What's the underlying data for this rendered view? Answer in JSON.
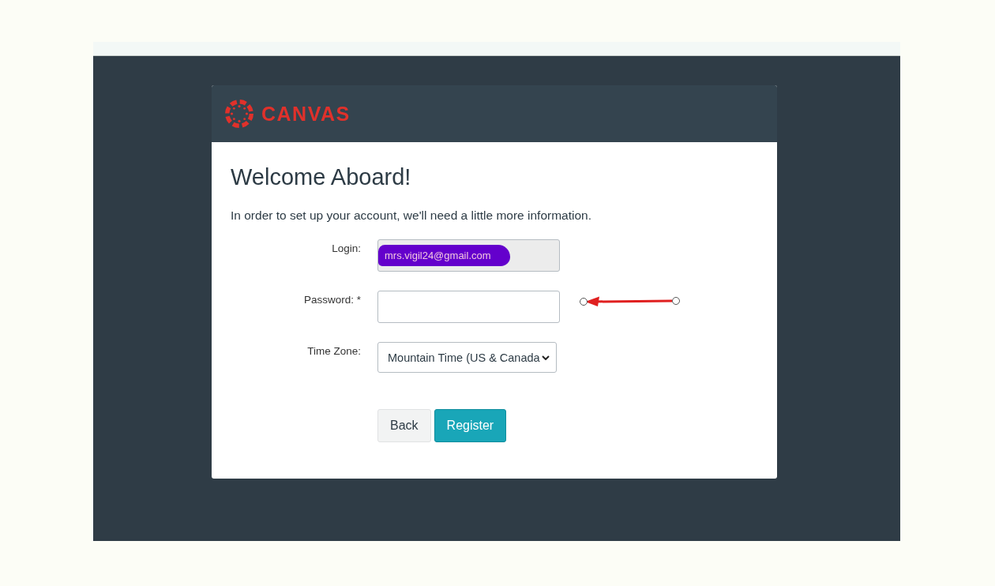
{
  "header": {
    "logo_text": "CANVAS"
  },
  "heading": "Welcome Aboard!",
  "intro": "In order to set up your account, we'll need a little more information.",
  "fields": [
    {
      "kind": "readonly",
      "label": "Login:",
      "value": "mrs.vigil24@gmail.com",
      "redacted": true
    },
    {
      "kind": "password",
      "label": "Password: *",
      "annotated": true
    },
    {
      "kind": "select",
      "label": "Time Zone:",
      "value": "Mountain Time (US & Canada"
    }
  ],
  "buttons": [
    {
      "kind": "secondary",
      "label": "Back"
    },
    {
      "kind": "primary",
      "label": "Register"
    }
  ]
}
